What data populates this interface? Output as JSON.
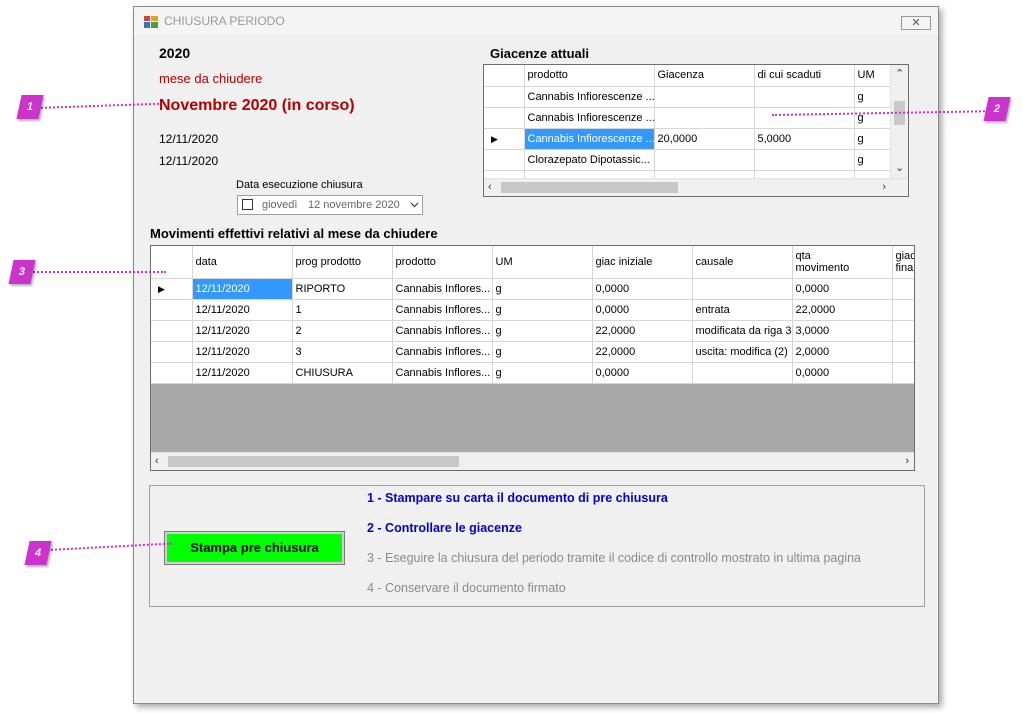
{
  "window": {
    "title": "CHIUSURA PERIODO",
    "close_glyph": "✕"
  },
  "header": {
    "year": "2020",
    "month_label": "mese da chiudere",
    "month_value": "Novembre 2020 (in corso)",
    "date1": "12/11/2020",
    "date2": "12/11/2020",
    "exec_label": "Data esecuzione chiusura",
    "exec_day": "giovedì",
    "exec_date": "12 novembre 2020"
  },
  "stock": {
    "title": "Giacenze attuali",
    "columns": [
      "prodotto",
      "Giacenza",
      "di cui scaduti",
      "UM"
    ],
    "rows": [
      [
        "Cannabis Infiorescenze ...",
        "",
        "",
        "g"
      ],
      [
        "Cannabis Infiorescenze ...",
        "",
        "",
        "g"
      ],
      [
        "Cannabis Infiorescenze ...",
        "20,0000",
        "5,0000",
        "g"
      ],
      [
        "Clorazepato Dipotassic...",
        "",
        "",
        "g"
      ],
      [
        "",
        "",
        "",
        ""
      ]
    ]
  },
  "moves": {
    "title": "Movimenti effettivi relativi al mese da chiudere",
    "columns": [
      "data",
      "prog prodotto",
      "prodotto",
      "UM",
      "giac iniziale",
      "causale",
      "qta\nmovimento",
      "giac\nfina"
    ],
    "rows": [
      [
        "12/11/2020",
        "RIPORTO",
        "Cannabis Inflores...",
        "g",
        "0,0000",
        "",
        "0,0000"
      ],
      [
        "12/11/2020",
        "1",
        "Cannabis Inflores...",
        "g",
        "0,0000",
        "entrata",
        "22,0000"
      ],
      [
        "12/11/2020",
        "2",
        "Cannabis Inflores...",
        "g",
        "22,0000",
        "modificata da riga 3",
        "3,0000"
      ],
      [
        "12/11/2020",
        "3",
        "Cannabis Inflores...",
        "g",
        "22,0000",
        "uscita: modifica (2)",
        "2,0000"
      ],
      [
        "12/11/2020",
        "CHIUSURA",
        "Cannabis Inflores...",
        "g",
        "0,0000",
        "",
        "0,0000"
      ]
    ]
  },
  "steps": {
    "button": "Stampa pre chiusura",
    "items": [
      "1 - Stampare su carta il documento di pre chiusura",
      "2 - Controllare le giacenze",
      "3 - Eseguire la chiusura del periodo tramite il codice di controllo mostrato in ultima pagina",
      "4 - Conservare il documento firmato"
    ]
  },
  "callouts": [
    "1",
    "2",
    "3",
    "4"
  ],
  "colors": {
    "accent_red": "#b00000",
    "step_active": "#0000cc",
    "step_inactive": "#8a8a8a",
    "button_green": "#00ff00",
    "callout": "#cc33cc",
    "selection": "#3399ff"
  }
}
